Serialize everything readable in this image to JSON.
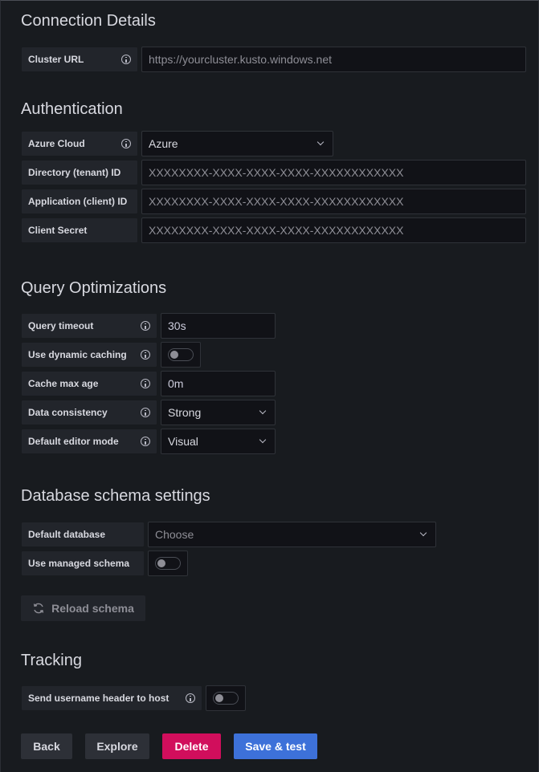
{
  "connection": {
    "title": "Connection Details",
    "cluster_url": {
      "label": "Cluster URL",
      "placeholder": "https://yourcluster.kusto.windows.net"
    }
  },
  "authentication": {
    "title": "Authentication",
    "azure_cloud": {
      "label": "Azure Cloud",
      "value": "Azure"
    },
    "directory_id": {
      "label": "Directory (tenant) ID",
      "placeholder": "XXXXXXXX-XXXX-XXXX-XXXX-XXXXXXXXXXXX"
    },
    "application_id": {
      "label": "Application (client) ID",
      "placeholder": "XXXXXXXX-XXXX-XXXX-XXXX-XXXXXXXXXXXX"
    },
    "client_secret": {
      "label": "Client Secret",
      "placeholder": "XXXXXXXX-XXXX-XXXX-XXXX-XXXXXXXXXXXX"
    }
  },
  "query": {
    "title": "Query Optimizations",
    "timeout": {
      "label": "Query timeout",
      "value": "30s"
    },
    "dynamic_caching": {
      "label": "Use dynamic caching",
      "enabled": false
    },
    "cache_max_age": {
      "label": "Cache max age",
      "value": "0m"
    },
    "data_consistency": {
      "label": "Data consistency",
      "value": "Strong"
    },
    "editor_mode": {
      "label": "Default editor mode",
      "value": "Visual"
    }
  },
  "schema": {
    "title": "Database schema settings",
    "default_database": {
      "label": "Default database",
      "placeholder": "Choose"
    },
    "managed_schema": {
      "label": "Use managed schema",
      "enabled": false
    },
    "reload_label": "Reload schema"
  },
  "tracking": {
    "title": "Tracking",
    "username_header": {
      "label": "Send username header to host",
      "enabled": false
    }
  },
  "actions": {
    "back": "Back",
    "explore": "Explore",
    "delete": "Delete",
    "save": "Save & test"
  },
  "colors": {
    "delete": "#d10e5c",
    "save": "#3d71d9",
    "secondary": "#2d3037"
  }
}
